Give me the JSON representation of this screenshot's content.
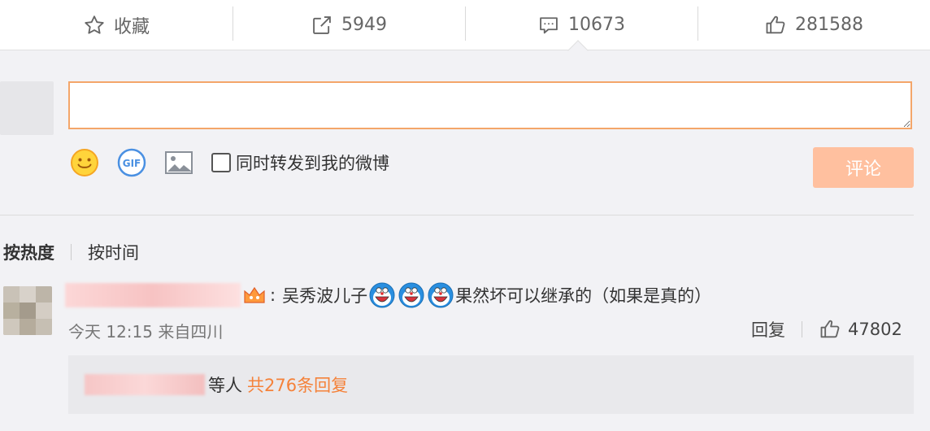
{
  "actionbar": {
    "favorite": {
      "label": "收藏",
      "icon": "star-icon"
    },
    "repost": {
      "count": "5949",
      "icon": "share-icon"
    },
    "comment": {
      "count": "10673",
      "icon": "comment-icon"
    },
    "like": {
      "count": "281588",
      "icon": "thumbs-up-icon"
    }
  },
  "composer": {
    "input_value": "",
    "tools": [
      "emoji-icon",
      "gif-icon",
      "image-icon"
    ],
    "repost_option_label": "同时转发到我的微博",
    "repost_checked": false,
    "submit_label": "评论"
  },
  "sort": {
    "hot_label": "按热度",
    "time_label": "按时间"
  },
  "comment": {
    "separator": ":",
    "text_before": "吴秀波儿子",
    "text_after": "果然坏可以继承的（如果是真的）",
    "emoji_count": 3,
    "meta": "今天 12:15 来自四川",
    "reply_label": "回复",
    "like_count": "47802",
    "replies": {
      "suffix": "等人",
      "total": "共276条回复"
    }
  },
  "colors": {
    "accent": "#f5823a",
    "input_border": "#f4a66a",
    "submit_bg": "#ffc09f",
    "background": "#f2f2f5"
  }
}
